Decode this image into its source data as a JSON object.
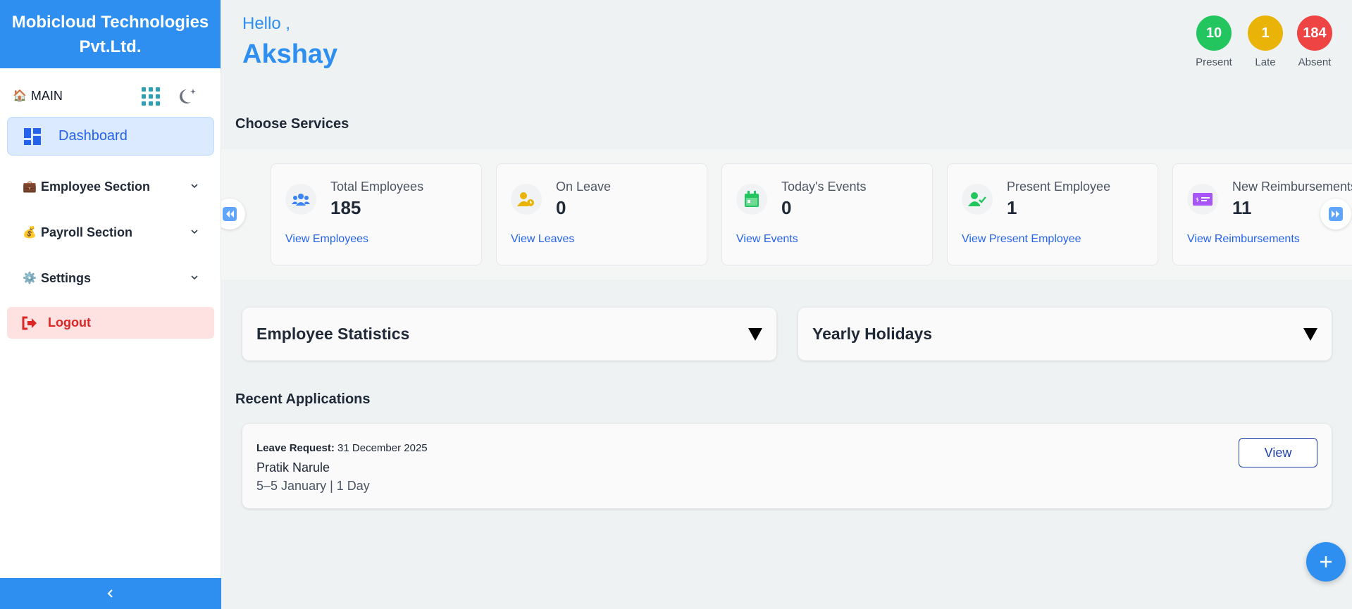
{
  "brand": {
    "name": "Mobicloud Technologies Pvt.Ltd."
  },
  "sidebar": {
    "main_label": "MAIN",
    "dashboard_label": "Dashboard",
    "items": [
      {
        "icon": "briefcase-icon",
        "label": "Employee Section"
      },
      {
        "icon": "money-bag-icon",
        "label": "Payroll Section"
      },
      {
        "icon": "gear-icon",
        "label": "Settings"
      }
    ],
    "logout_label": "Logout"
  },
  "header": {
    "greeting": "Hello ,",
    "username": "Akshay",
    "stats": [
      {
        "value": "10",
        "label": "Present",
        "color": "#22c55e"
      },
      {
        "value": "1",
        "label": "Late",
        "color": "#eab308"
      },
      {
        "value": "184",
        "label": "Absent",
        "color": "#ef4444"
      }
    ]
  },
  "services": {
    "title": "Choose Services",
    "cards": [
      {
        "icon": "users-icon",
        "title": "Total Employees",
        "value": "185",
        "link": "View Employees",
        "icon_color": "#3b82f6"
      },
      {
        "icon": "user-clock-icon",
        "title": "On Leave",
        "value": "0",
        "link": "View Leaves",
        "icon_color": "#eab308"
      },
      {
        "icon": "calendar-icon",
        "title": "Today's Events",
        "value": "0",
        "link": "View Events",
        "icon_color": "#22c55e"
      },
      {
        "icon": "user-check-icon",
        "title": "Present Employee",
        "value": "1",
        "link": "View Present Employee",
        "icon_color": "#22c55e"
      },
      {
        "icon": "money-check-icon",
        "title": "New Reimbursements",
        "value": "11",
        "link": "View Reimbursements",
        "icon_color": "#a855f7"
      }
    ]
  },
  "accordions": [
    {
      "title": "Employee Statistics"
    },
    {
      "title": "Yearly Holidays"
    }
  ],
  "recent": {
    "title": "Recent Applications",
    "items": [
      {
        "type": "Leave Request:",
        "date": "31 December 2025",
        "name": "Pratik Narule",
        "meta": "5–5 January | 1 Day",
        "view_label": "View"
      }
    ]
  },
  "colors": {
    "primary": "#2e8ff0",
    "accent": "#2563eb",
    "danger": "#dc2626"
  }
}
